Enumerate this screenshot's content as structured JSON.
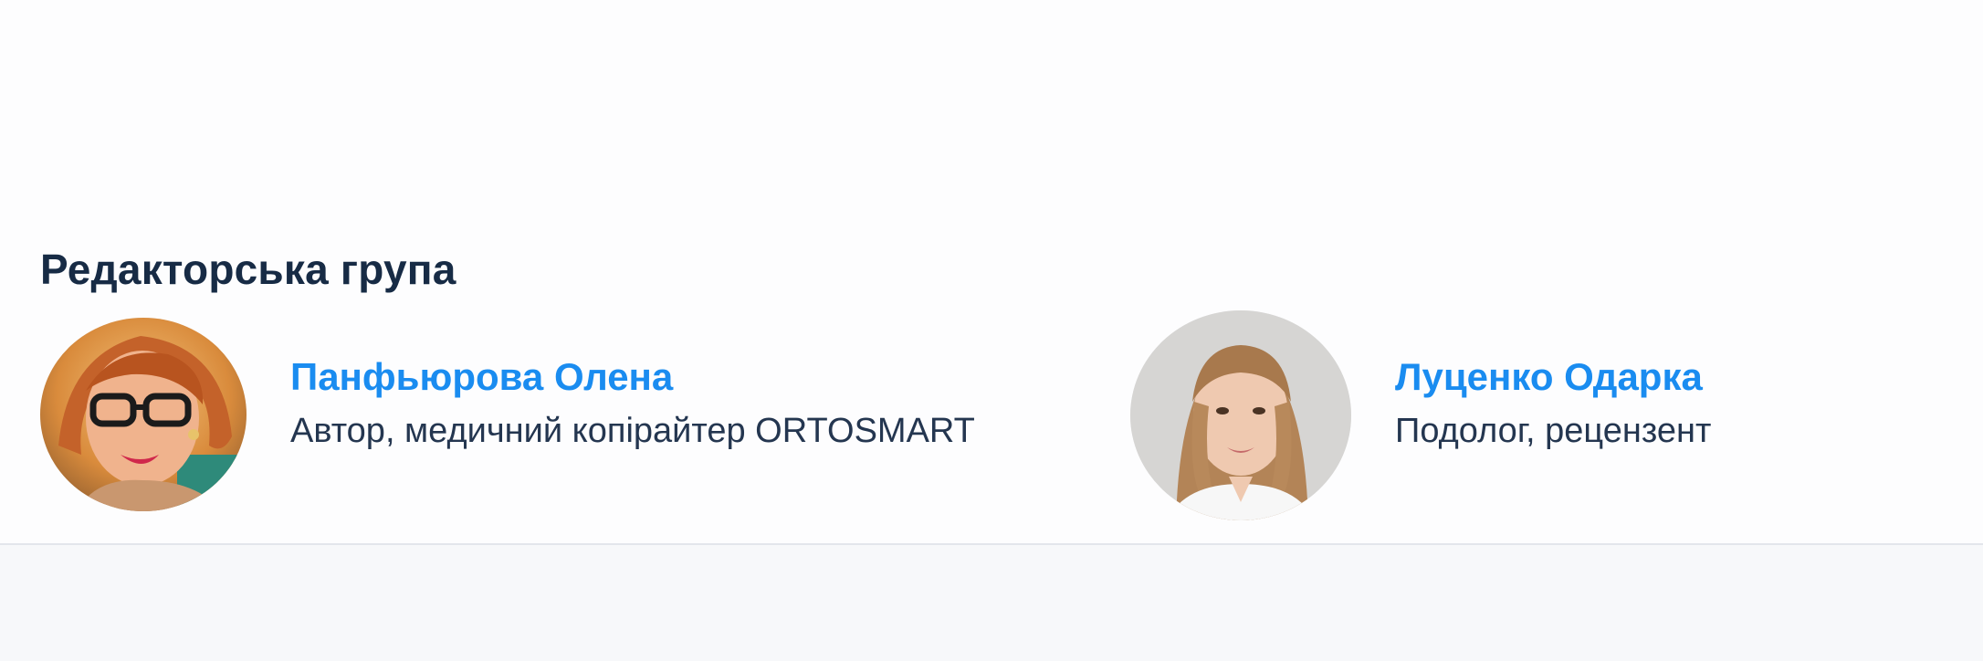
{
  "editorial": {
    "title": "Редакторська група",
    "members": [
      {
        "name": "Панфьюрова Олена",
        "role": "Автор, медичний копірайтер ORTOSMART",
        "avatar_icon": "author-photo"
      },
      {
        "name": "Луценко Одарка",
        "role": "Подолог, рецензент",
        "avatar_icon": "reviewer-photo"
      }
    ]
  },
  "colors": {
    "heading": "#172b45",
    "link": "#1a8cf0",
    "text": "#243650",
    "divider": "#e3e6ec",
    "background": "#fdfdfe"
  }
}
